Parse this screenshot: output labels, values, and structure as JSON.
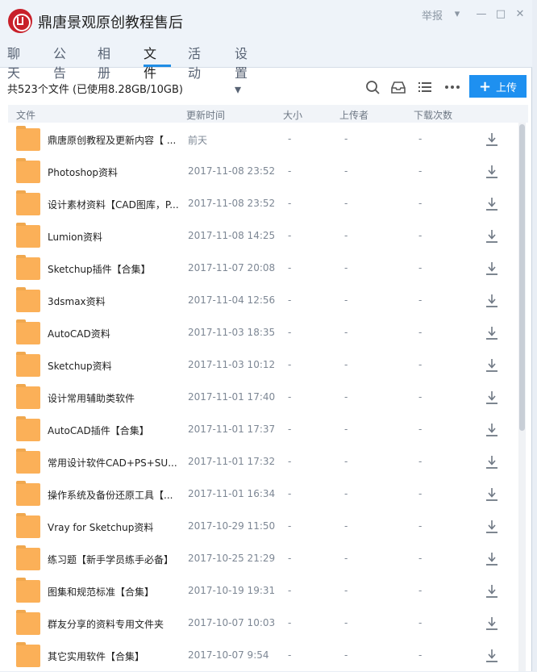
{
  "window": {
    "title": "鼎唐景观原创教程售后",
    "report": "举报",
    "controls": [
      "▾",
      "—",
      "□",
      "✕"
    ]
  },
  "tabs": [
    {
      "label": "聊天"
    },
    {
      "label": "公告"
    },
    {
      "label": "相册"
    },
    {
      "label": "文件"
    },
    {
      "label": "活动"
    },
    {
      "label": "设置 ▾"
    }
  ],
  "toolbar": {
    "summary": "共523个文件 (已使用8.28GB/10GB)",
    "upload_label": "上传"
  },
  "columns": [
    "文件",
    "更新时间",
    "大小",
    "上传者",
    "下载次数"
  ],
  "files": [
    {
      "name": "鼎唐原创教程及更新内容【 ...",
      "time": "前天",
      "size": "-",
      "uploader": "-",
      "downloads": "-"
    },
    {
      "name": "Photoshop资料",
      "time": "2017-11-08 23:52",
      "size": "-",
      "uploader": "-",
      "downloads": "-"
    },
    {
      "name": "设计素材资料【CAD图库，P...",
      "time": "2017-11-08 23:52",
      "size": "-",
      "uploader": "-",
      "downloads": "-"
    },
    {
      "name": "Lumion资料",
      "time": "2017-11-08 14:25",
      "size": "-",
      "uploader": "-",
      "downloads": "-"
    },
    {
      "name": "Sketchup插件【合集】",
      "time": "2017-11-07 20:08",
      "size": "-",
      "uploader": "-",
      "downloads": "-"
    },
    {
      "name": "3dsmax资料",
      "time": "2017-11-04 12:56",
      "size": "-",
      "uploader": "-",
      "downloads": "-"
    },
    {
      "name": "AutoCAD资料",
      "time": "2017-11-03 18:35",
      "size": "-",
      "uploader": "-",
      "downloads": "-"
    },
    {
      "name": "Sketchup资料",
      "time": "2017-11-03 10:12",
      "size": "-",
      "uploader": "-",
      "downloads": "-"
    },
    {
      "name": "设计常用辅助类软件",
      "time": "2017-11-01 17:40",
      "size": "-",
      "uploader": "-",
      "downloads": "-"
    },
    {
      "name": "AutoCAD插件【合集】",
      "time": "2017-11-01 17:37",
      "size": "-",
      "uploader": "-",
      "downloads": "-"
    },
    {
      "name": "常用设计软件CAD+PS+SU...",
      "time": "2017-11-01 17:32",
      "size": "-",
      "uploader": "-",
      "downloads": "-"
    },
    {
      "name": "操作系统及备份还原工具【...",
      "time": "2017-11-01 16:34",
      "size": "-",
      "uploader": "-",
      "downloads": "-"
    },
    {
      "name": "Vray for Sketchup资料",
      "time": "2017-10-29 11:50",
      "size": "-",
      "uploader": "-",
      "downloads": "-"
    },
    {
      "name": "练习题【新手学员练手必备】",
      "time": "2017-10-25 21:29",
      "size": "-",
      "uploader": "-",
      "downloads": "-"
    },
    {
      "name": "图集和规范标准【合集】",
      "time": "2017-10-19 19:31",
      "size": "-",
      "uploader": "-",
      "downloads": "-"
    },
    {
      "name": "群友分享的资料专用文件夹",
      "time": "2017-10-07 10:03",
      "size": "-",
      "uploader": "-",
      "downloads": "-"
    },
    {
      "name": "其它实用软件【合集】",
      "time": "2017-10-07 9:54",
      "size": "-",
      "uploader": "-",
      "downloads": "-"
    }
  ],
  "icons": {
    "app_logo": "app-logo",
    "folder": "folder-icon",
    "download": "download-icon",
    "search": "search-icon",
    "inbox": "inbox-icon",
    "list_view": "list-view-icon",
    "more": "more-icon"
  },
  "colors": {
    "accent": "#1e90f0",
    "folder": "#fbb058",
    "logo": "#c8202a"
  }
}
